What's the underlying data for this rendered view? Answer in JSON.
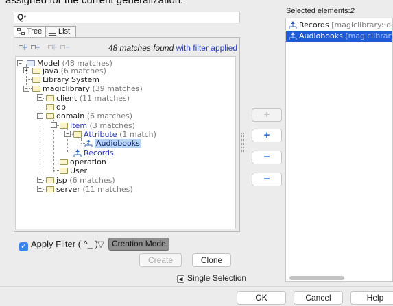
{
  "top_note": "assigned for the current generalization.",
  "search": {
    "placeholder": ""
  },
  "tabs": [
    {
      "label": "Tree",
      "icon": "tree-view-icon",
      "active": true
    },
    {
      "label": "List",
      "icon": "list-view-icon",
      "active": false
    }
  ],
  "toolbar": {
    "icons": [
      "expand-all-icon",
      "collapse-all-icon",
      "expand-selected-icon",
      "collapse-selected-icon"
    ],
    "matches_text": "48 matches found",
    "filter_text": "with filter applied"
  },
  "tree": {
    "model": {
      "label": "Model",
      "count": "(48 matches)"
    },
    "java": {
      "label": "java",
      "count": "(6 matches)"
    },
    "library_system": {
      "label": "Library System"
    },
    "magiclibrary": {
      "label": "magiclibrary",
      "count": "(39 matches)"
    },
    "client": {
      "label": "client",
      "count": "(11 matches)"
    },
    "db": {
      "label": "db"
    },
    "domain": {
      "label": "domain",
      "count": "(6 matches)"
    },
    "item": {
      "label": "Item",
      "count": "(3 matches)"
    },
    "attribute": {
      "label": "Attribute",
      "count": "(1 match)"
    },
    "audiobooks": {
      "label": "Audiobooks"
    },
    "records": {
      "label": "Records"
    },
    "operation": {
      "label": "operation"
    },
    "user": {
      "label": "User"
    },
    "jsp": {
      "label": "jsp",
      "count": "(6 matches)"
    },
    "server": {
      "label": "server",
      "count": "(11 matches)"
    }
  },
  "filter": {
    "apply_label": "Apply Filter ( ^_ )",
    "apply_checked": true,
    "creation_mode_label": "Creation Mode"
  },
  "buttons": {
    "create": "Create",
    "clone": "Clone",
    "single_selection": "Single Selection",
    "ok": "OK",
    "cancel": "Cancel",
    "help": "Help"
  },
  "side_buttons": [
    "+",
    "+",
    "−",
    "−"
  ],
  "selected": {
    "label": "Selected elements:",
    "count": "2",
    "items": [
      {
        "name": "Records",
        "qualifier": "[magiclibrary::dor",
        "highlighted": false
      },
      {
        "name": "Audiobooks",
        "qualifier": "[magiclibrary:",
        "highlighted": true
      }
    ]
  },
  "colors": {
    "accent": "#1f5bd6",
    "filter_link": "#2b3fb5",
    "selection_bg": "#b6d4f4"
  }
}
